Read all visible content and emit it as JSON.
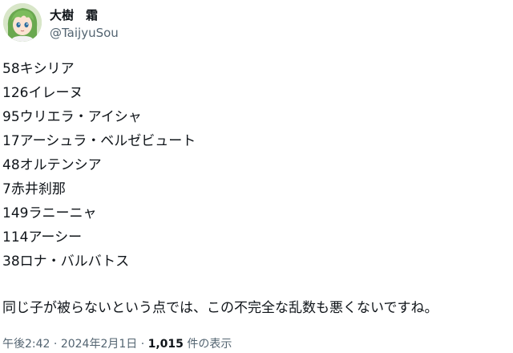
{
  "author": {
    "display_name": "大樹　霜",
    "handle": "@TaijyuSou"
  },
  "tweet": {
    "lines": [
      "58キシリア",
      "126イレーヌ",
      "95ウリエラ・アイシャ",
      "17アーシュラ・ベルゼビュート",
      "48オルテンシア",
      "7赤井刹那",
      "149ラニーニャ",
      "114アーシー",
      "38ロナ・バルバトス"
    ],
    "comment": "同じ子が被らないという点では、この不完全な乱数も悪くないですね。"
  },
  "meta": {
    "time": "午後2:42",
    "separator": "·",
    "date": "2024年2月1日",
    "views_count": "1,015",
    "views_label": "件の表示"
  },
  "icons": {
    "avatar": "anime-character-avatar"
  },
  "colors": {
    "text_primary": "#0f1419",
    "text_secondary": "#536471"
  }
}
